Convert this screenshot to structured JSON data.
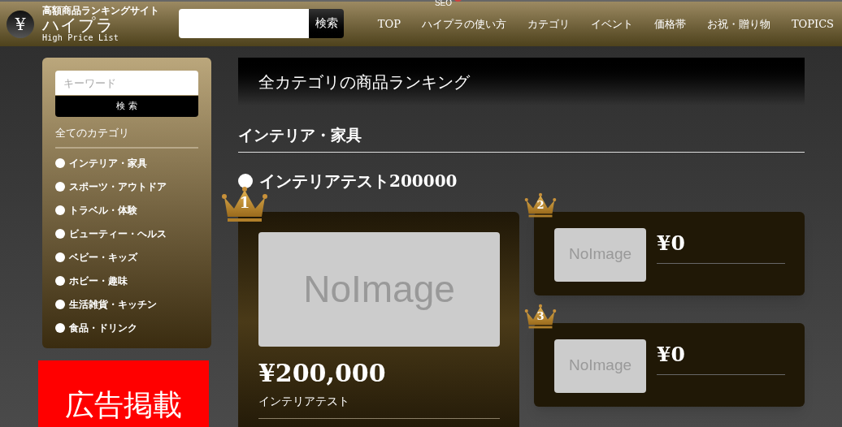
{
  "header": {
    "logo": {
      "symbol": "¥",
      "tagline": "高額商品ランキングサイト",
      "name": "ハイプラ",
      "subtitle": "High Price List"
    },
    "search": {
      "button": "検索"
    },
    "nav": [
      {
        "label": "TOP"
      },
      {
        "label": "ハイプラの使い方",
        "badge": "SEO"
      },
      {
        "label": "カテゴリ"
      },
      {
        "label": "イベント"
      },
      {
        "label": "価格帯"
      },
      {
        "label": "お祝・贈り物"
      },
      {
        "label": "TOPICS"
      }
    ]
  },
  "sidebar": {
    "search": {
      "placeholder": "キーワード",
      "button": "検 索"
    },
    "heading": "全てのカテゴリ",
    "categories": [
      "インテリア・家具",
      "スポーツ・アウトドア",
      "トラベル・体験",
      "ビューティー・ヘルス",
      "ベビー・キッズ",
      "ホビー・趣味",
      "生活雑貨・キッチン",
      "食品・ドリンク"
    ],
    "ad": "広告掲載"
  },
  "main": {
    "title": "全カテゴリの商品ランキング",
    "section": "インテリア・家具",
    "subsection": "インテリアテスト200000",
    "ranking": [
      {
        "rank": "1",
        "image": "NoImage",
        "price": "¥200,000",
        "name": "インテリアテスト"
      },
      {
        "rank": "2",
        "image": "NoImage",
        "price": "¥0"
      },
      {
        "rank": "3",
        "image": "NoImage",
        "price": "¥0"
      }
    ]
  }
}
